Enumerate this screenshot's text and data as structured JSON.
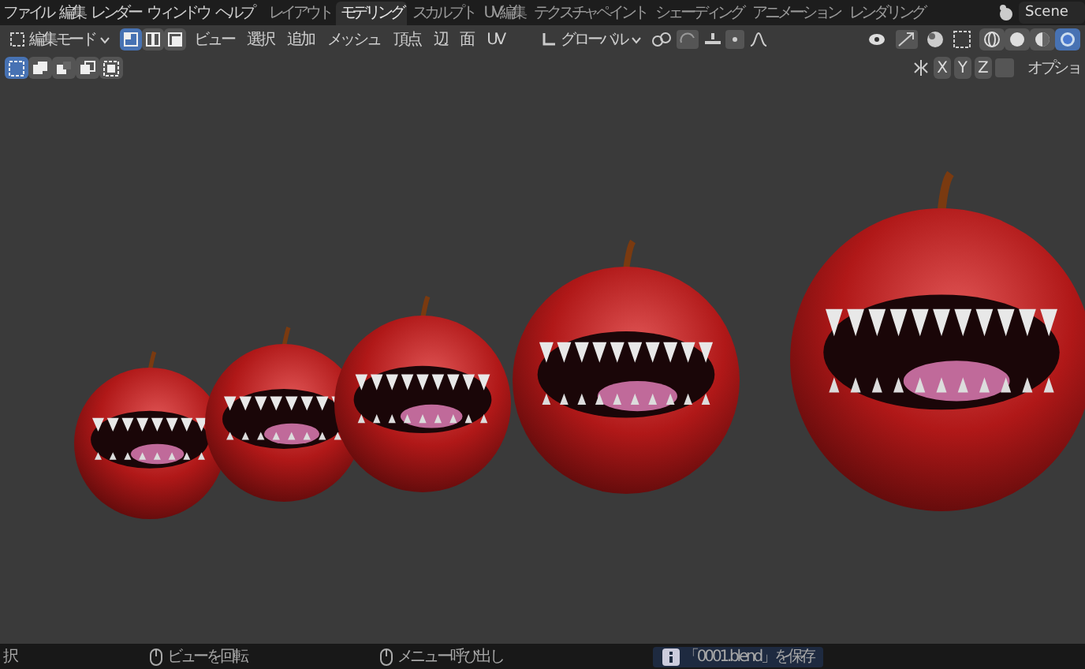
{
  "menu": [
    "ファイル",
    "編集",
    "レンダー",
    "ウィンドウ",
    "ヘルプ"
  ],
  "workspace_tabs": [
    {
      "label": "レイアウト",
      "selected": false
    },
    {
      "label": "モデリング",
      "selected": true
    },
    {
      "label": "スカルプト",
      "selected": false
    },
    {
      "label": "UV編集",
      "selected": false
    },
    {
      "label": "テクスチャペイント",
      "selected": false
    },
    {
      "label": "シェーディング",
      "selected": false
    },
    {
      "label": "アニメーション",
      "selected": false
    },
    {
      "label": "レンダリング",
      "selected": false
    }
  ],
  "scene": {
    "name": "Scene"
  },
  "header": {
    "mode": "編集モード",
    "select_modes": [
      {
        "kind": "vertex",
        "selected": true
      },
      {
        "kind": "edge",
        "selected": false
      },
      {
        "kind": "face",
        "selected": false
      }
    ],
    "menus": [
      "ビュー",
      "選択",
      "追加",
      "メッシュ",
      "頂点",
      "辺",
      "面",
      "UV"
    ],
    "orientation": "グローバル",
    "shading_modes": [
      {
        "kind": "wireframe",
        "selected": false
      },
      {
        "kind": "solid",
        "selected": false
      },
      {
        "kind": "material",
        "selected": false
      },
      {
        "kind": "rendered",
        "selected": true
      }
    ]
  },
  "toolbar": {
    "select_tools": [
      {
        "kind": "new",
        "selected": true
      },
      {
        "kind": "extend",
        "selected": false
      },
      {
        "kind": "subtract",
        "selected": false
      },
      {
        "kind": "invert",
        "selected": false
      },
      {
        "kind": "intersect",
        "selected": false
      }
    ],
    "axes": [
      "X",
      "Y",
      "Z"
    ],
    "options": "オプショ"
  },
  "status_bar": [
    {
      "kind": "text",
      "text": "択"
    },
    {
      "kind": "mouse",
      "text": "ビューを回転"
    },
    {
      "kind": "mouse",
      "text": "メニュー呼び出し"
    },
    {
      "kind": "info",
      "text": "「0001.blend」を保存"
    }
  ]
}
